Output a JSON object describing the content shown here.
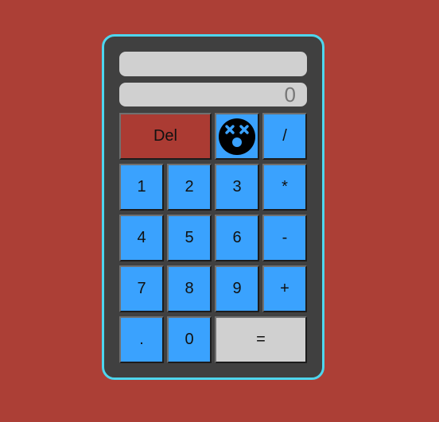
{
  "display": {
    "previous": "",
    "current": "0"
  },
  "keys": {
    "del": "Del",
    "face_icon": "dizzy-face-icon",
    "divide": "/",
    "seven": "7",
    "eight": "8",
    "nine": "9",
    "one": "1",
    "two": "2",
    "three": "3",
    "multiply": "*",
    "four": "4",
    "five": "5",
    "six": "6",
    "minus": "-",
    "plus": "+",
    "decimal": ".",
    "zero": "0",
    "equals": "="
  },
  "colors": {
    "background": "#ac3f36",
    "body": "#404040",
    "border": "#4ed6ee",
    "key": "#3aa2fe",
    "del_key": "#ab3b33",
    "screen": "#d0d0d0",
    "face": "#000000",
    "face_features": "#3aa2fe"
  }
}
